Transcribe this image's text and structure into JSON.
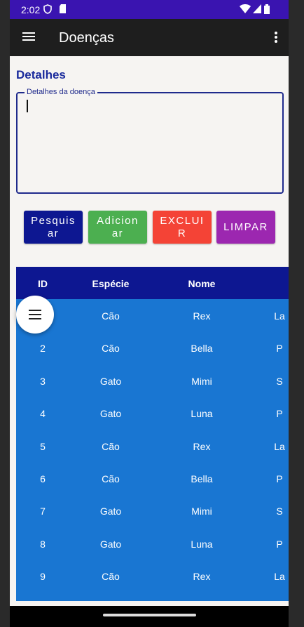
{
  "status": {
    "time": "2:02",
    "icons": [
      "shield-icon",
      "sd-card-icon",
      "wifi-icon",
      "signal-icon",
      "battery-icon"
    ]
  },
  "appbar": {
    "title": "Doenças",
    "menu_icon": "hamburger-menu-icon",
    "more_icon": "more-vert-icon"
  },
  "details": {
    "section_title": "Detalhes",
    "field_label": "Detalhes da doença",
    "field_value": ""
  },
  "buttons": [
    {
      "label": "Pesquisar",
      "color": "#0d1791"
    },
    {
      "label": "Adicionar",
      "color": "#4caf50"
    },
    {
      "label": "EXCLUIR",
      "color": "#f44336"
    },
    {
      "label": "LIMPAR",
      "color": "#9c27b0"
    }
  ],
  "table": {
    "headers": [
      "ID",
      "Espécie",
      "Nome"
    ],
    "rows": [
      {
        "id": "",
        "especie": "Cão",
        "nome": "Rex",
        "extra": "La"
      },
      {
        "id": "2",
        "especie": "Cão",
        "nome": "Bella",
        "extra": "P"
      },
      {
        "id": "3",
        "especie": "Gato",
        "nome": "Mimi",
        "extra": "S"
      },
      {
        "id": "4",
        "especie": "Gato",
        "nome": "Luna",
        "extra": "P"
      },
      {
        "id": "5",
        "especie": "Cão",
        "nome": "Rex",
        "extra": "La"
      },
      {
        "id": "6",
        "especie": "Cão",
        "nome": "Bella",
        "extra": "P"
      },
      {
        "id": "7",
        "especie": "Gato",
        "nome": "Mimi",
        "extra": "S"
      },
      {
        "id": "8",
        "especie": "Gato",
        "nome": "Luna",
        "extra": "P"
      },
      {
        "id": "9",
        "especie": "Cão",
        "nome": "Rex",
        "extra": "La"
      }
    ]
  },
  "fab": {
    "icon": "menu-icon"
  },
  "colors": {
    "status_bar": "#3a14b0",
    "app_bar": "#1e1e1e",
    "accent": "#1a2a9c",
    "table_header": "#0d1791",
    "table_body": "#1976d2"
  }
}
